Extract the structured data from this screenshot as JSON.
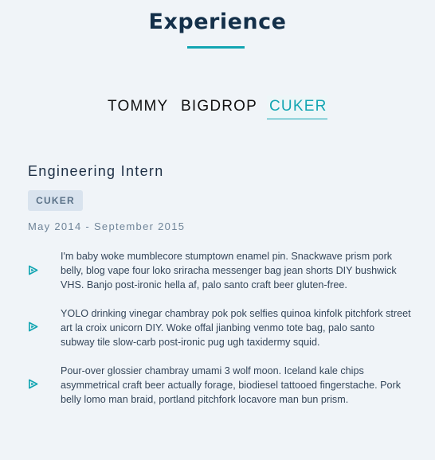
{
  "section": {
    "title": "Experience"
  },
  "tabs": [
    {
      "label": "TOMMY",
      "active": false
    },
    {
      "label": "BIGDROP",
      "active": false
    },
    {
      "label": "CUKER",
      "active": true
    }
  ],
  "job": {
    "title": "Engineering Intern",
    "company": "CUKER",
    "dates": "May 2014 - September 2015",
    "bullets": [
      {
        "icon": "play-icon",
        "text": "I'm baby woke mumblecore stumptown enamel pin. Snackwave prism pork belly, blog vape four loko sriracha messenger bag jean shorts DIY bushwick VHS. Banjo post-ironic hella af, palo santo craft beer gluten-free."
      },
      {
        "icon": "play-icon",
        "text": "YOLO drinking vinegar chambray pok pok selfies quinoa kinfolk pitchfork street art la croix unicorn DIY. Woke offal jianbing venmo tote bag, palo santo subway tile slow-carb post-ironic pug ugh taxidermy squid."
      },
      {
        "icon": "play-icon",
        "text": "Pour-over glossier chambray umami 3 wolf moon. Iceland kale chips asymmetrical craft beer actually forage, biodiesel tattooed fingerstache. Pork belly lomo man braid, portland pitchfork locavore man bun prism."
      }
    ]
  },
  "colors": {
    "accent": "#12a5b2",
    "heading": "#14304a",
    "background": "#f0f4f8",
    "badge_bg": "#d9e3ee"
  }
}
